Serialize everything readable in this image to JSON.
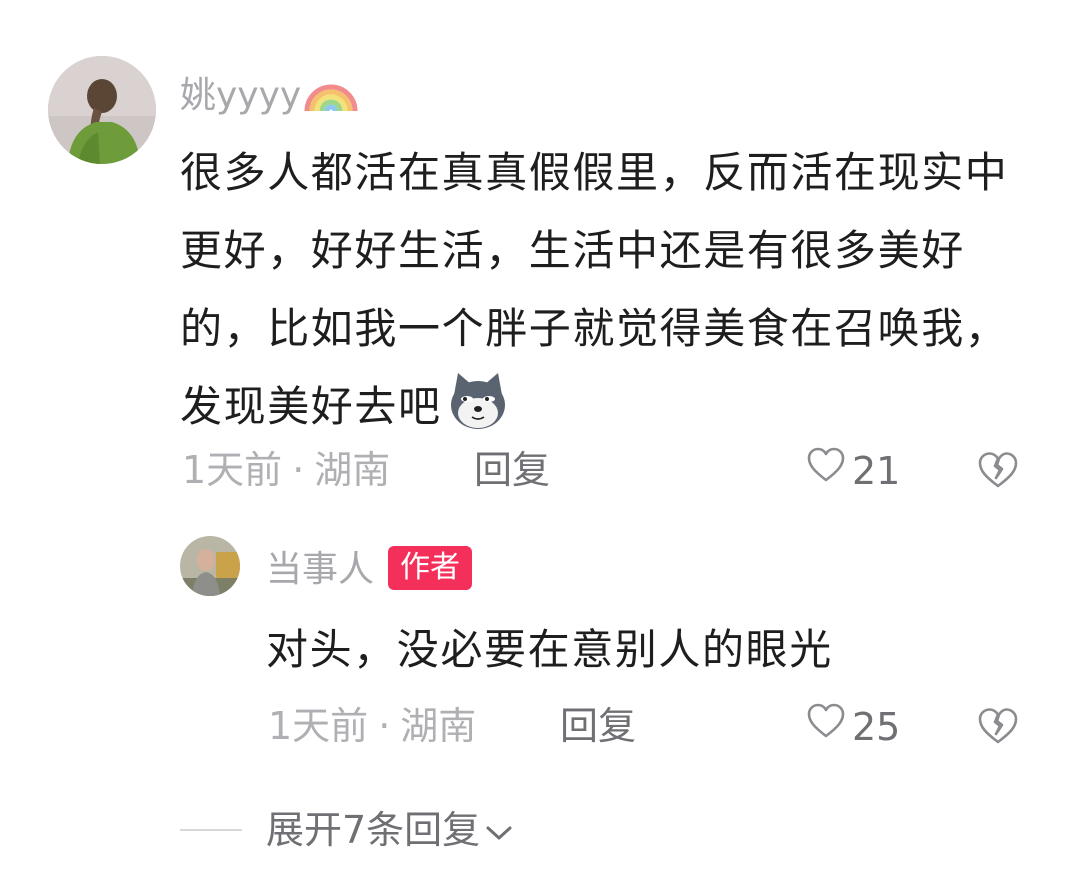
{
  "comment": {
    "username": "姚yyyy",
    "text": "很多人都活在真真假假里，反而活在现实中更好，好好生活，生活中还是有很多美好的，比如我一个胖子就觉得美食在召唤我，发现美好去吧",
    "time": "1天前",
    "location": "湖南",
    "reply_label": "回复",
    "likes": "21",
    "icons": [
      "avatar",
      "rainbow-emoji",
      "doge-emoji",
      "heart-outline-icon",
      "broken-heart-icon"
    ]
  },
  "reply": {
    "username": "当事人",
    "badge": "作者",
    "text": "对头，没必要在意别人的眼光",
    "time": "1天前",
    "location": "湖南",
    "reply_label": "回复",
    "likes": "25",
    "badge_color": "#f4305a"
  },
  "expand": {
    "label": "展开7条回复"
  },
  "separator": "·"
}
